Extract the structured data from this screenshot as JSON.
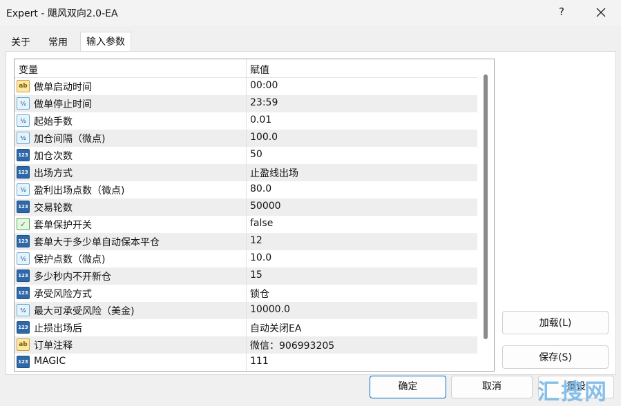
{
  "window": {
    "title": "Expert - 飓风双向2.0-EA",
    "help_label": "?",
    "close_icon": "close-icon"
  },
  "tabs": [
    {
      "label": "关于",
      "active": false
    },
    {
      "label": "常用",
      "active": false
    },
    {
      "label": "输入参数",
      "active": true
    }
  ],
  "grid": {
    "headers": {
      "variable": "变量",
      "value": "赋值"
    },
    "rows": [
      {
        "icon": "ab",
        "name": "做单启动时间",
        "value": "00:00"
      },
      {
        "icon": "half",
        "name": "做单停止时间",
        "value": "23:59"
      },
      {
        "icon": "half",
        "name": "起始手数",
        "value": "0.01"
      },
      {
        "icon": "half",
        "name": "加仓间隔（微点)",
        "value": "100.0"
      },
      {
        "icon": "num",
        "name": "加仓次数",
        "value": "50"
      },
      {
        "icon": "num",
        "name": "出场方式",
        "value": "止盈线出场"
      },
      {
        "icon": "half",
        "name": "盈利出场点数（微点)",
        "value": "80.0"
      },
      {
        "icon": "num",
        "name": "交易轮数",
        "value": "50000"
      },
      {
        "icon": "bool",
        "name": "套单保护开关",
        "value": "false"
      },
      {
        "icon": "num",
        "name": "套单大于多少单自动保本平仓",
        "value": "12"
      },
      {
        "icon": "half",
        "name": "保护点数（微点)",
        "value": "10.0"
      },
      {
        "icon": "num",
        "name": "多少秒内不开新仓",
        "value": "15"
      },
      {
        "icon": "num",
        "name": "承受风险方式",
        "value": "锁仓"
      },
      {
        "icon": "half",
        "name": "最大可承受风险（美金)",
        "value": "10000.0"
      },
      {
        "icon": "num",
        "name": "止损出场后",
        "value": "自动关闭EA"
      },
      {
        "icon": "ab",
        "name": "订单注释",
        "value": "微信：906993205"
      },
      {
        "icon": "num",
        "name": "MAGIC",
        "value": "111"
      }
    ]
  },
  "buttons": {
    "load": "加载(L)",
    "save": "保存(S)",
    "ok": "确定",
    "cancel": "取消",
    "reset": "重设"
  },
  "watermark": "汇搜网",
  "colors": {
    "accent": "#0067c0",
    "row_alt": "#eeeeee",
    "panel": "#ffffff",
    "window_bg": "#f0f0f0"
  }
}
